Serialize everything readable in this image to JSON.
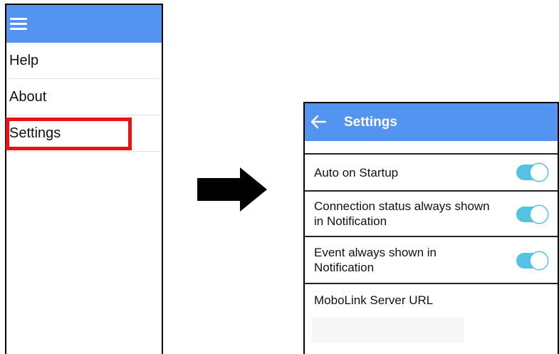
{
  "drawer": {
    "menu_items": [
      {
        "label": "Help"
      },
      {
        "label": "About"
      },
      {
        "label": "Settings"
      }
    ],
    "highlighted_item": "Settings",
    "highlight_color": "#ee1111",
    "header_color": "#5294ef",
    "icons": {
      "menu": "hamburger-menu-icon"
    }
  },
  "settings_screen": {
    "title": "Settings",
    "icons": {
      "back": "back-arrow-icon"
    },
    "rows": [
      {
        "label": "Auto on Startup",
        "toggle_on": true
      },
      {
        "label": "Connection status always shown in Notification",
        "toggle_on": true
      },
      {
        "label": "Event always shown in Notification",
        "toggle_on": true
      },
      {
        "label": "MoboLink Server URL"
      }
    ],
    "server_url_value": "",
    "toggle_color": "#54c2e2"
  }
}
